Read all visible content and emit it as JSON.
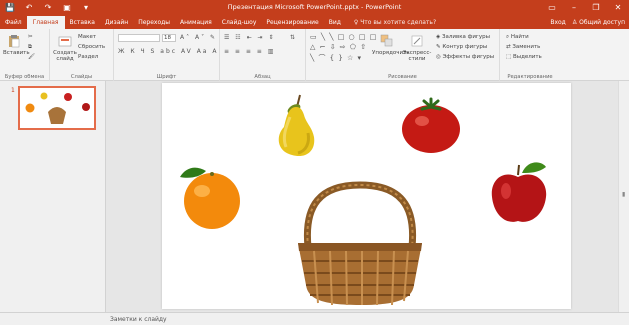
{
  "window": {
    "title": "Презентация Microsoft PowerPoint.pptx - PowerPoint",
    "controls": [
      "▭",
      "–",
      "❐",
      "✕"
    ]
  },
  "qat": {
    "save": "💾",
    "undo": "↶",
    "redo": "↷",
    "start": "▣",
    "more": "▾"
  },
  "tabs": [
    "Файл",
    "Главная",
    "Вставка",
    "Дизайн",
    "Переходы",
    "Анимация",
    "Слайд-шоу",
    "Рецензирование",
    "Вид"
  ],
  "active_tab": "Главная",
  "tell_me": "♀ Что вы хотите сделать?",
  "tabrow_right": {
    "signin": "Вход",
    "share": "♙ Общий доступ"
  },
  "ribbon": {
    "clipboard": {
      "label": "Буфер обмена",
      "paste": "Вставить"
    },
    "slides": {
      "label": "Слайды",
      "new_slide": "Создать слайд",
      "layout": "Макет",
      "reset": "Сбросить",
      "section": "Раздел"
    },
    "font": {
      "label": "Шрифт",
      "size": "18",
      "row2": "Ж К Ч S abc AV Aa A"
    },
    "paragraph": {
      "label": "Абзац"
    },
    "drawing": {
      "label": "Рисование",
      "arrange": "Упорядочить",
      "quick_styles": "Экспресс-стили",
      "fill": "Заливка фигуры",
      "outline": "Контур фигуры",
      "effects": "Эффекты фигуры"
    },
    "editing": {
      "label": "Редактирование",
      "find": "Найти",
      "replace": "Заменить",
      "select": "Выделить"
    }
  },
  "thumbnail": {
    "number": "1"
  },
  "slide": {
    "items": [
      "pear",
      "tomato",
      "orange",
      "apple",
      "basket"
    ]
  },
  "notes": {
    "label": "Заметки к слайду"
  },
  "colors": {
    "accent": "#c43e1c",
    "ribbon": "#f3f3f3",
    "workspace": "#e6e6e6"
  }
}
